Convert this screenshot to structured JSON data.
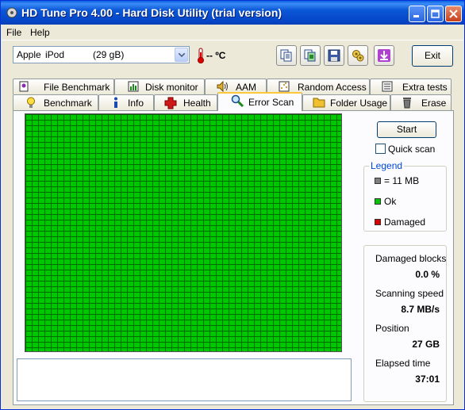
{
  "window": {
    "title": "HD Tune Pro 4.00 - Hard Disk Utility (trial version)"
  },
  "menu": [
    {
      "label": "File"
    },
    {
      "label": "Help"
    }
  ],
  "toolbar": {
    "drive": {
      "brand": "Apple",
      "model": "iPod",
      "size": "(29 gB)"
    },
    "temperature": "-- ºC",
    "exit_label": "Exit",
    "icons": [
      "copy-text-icon",
      "copy-screenshot-icon",
      "save-icon",
      "options-icon",
      "download-icon"
    ]
  },
  "tabs": {
    "top_row": [
      {
        "label": "File Benchmark",
        "icon": "file-benchmark-icon"
      },
      {
        "label": "Disk monitor",
        "icon": "disk-monitor-icon"
      },
      {
        "label": "AAM",
        "icon": "speaker-icon"
      },
      {
        "label": "Random Access",
        "icon": "random-access-icon"
      },
      {
        "label": "Extra tests",
        "icon": "extra-tests-icon"
      }
    ],
    "bottom_row": [
      {
        "label": "Benchmark",
        "icon": "lightbulb-icon"
      },
      {
        "label": "Info",
        "icon": "info-icon"
      },
      {
        "label": "Health",
        "icon": "health-cross-icon"
      },
      {
        "label": "Error Scan",
        "icon": "magnifier-icon",
        "active": true
      },
      {
        "label": "Folder Usage",
        "icon": "folder-icon"
      },
      {
        "label": "Erase",
        "icon": "trash-icon"
      }
    ]
  },
  "error_scan": {
    "start_label": "Start",
    "quick_scan_label": "Quick scan",
    "quick_scan_checked": false,
    "legend": {
      "title": "Legend",
      "items": [
        {
          "label": "= 11 MB",
          "color": "#808080"
        },
        {
          "label": "Ok",
          "color": "#00c800"
        },
        {
          "label": "Damaged",
          "color": "#e00000"
        }
      ]
    },
    "stats": {
      "damaged_blocks_label": "Damaged blocks",
      "damaged_blocks_value": "0.0 %",
      "scanning_speed_label": "Scanning speed",
      "scanning_speed_value": "8.7 MB/s",
      "position_label": "Position",
      "position_value": "27 GB",
      "elapsed_label": "Elapsed time",
      "elapsed_value": "37:01"
    },
    "grid_status": "ok"
  },
  "colors": {
    "ok_block": "#00c800",
    "titlebar": "#0a57d6"
  }
}
